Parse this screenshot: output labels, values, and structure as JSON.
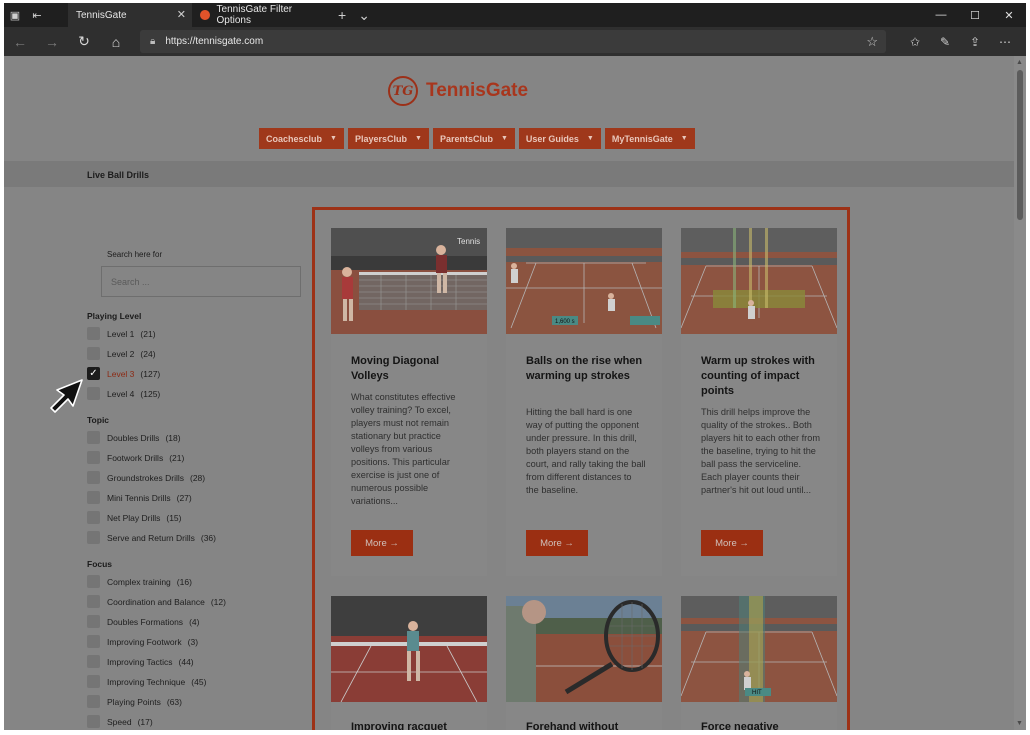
{
  "browser": {
    "tabs": [
      {
        "label": "TennisGate"
      },
      {
        "label": "TennisGate Filter Options"
      }
    ],
    "url": "https://tennisgate.com"
  },
  "site": {
    "logo_text": "TennisGate",
    "logo_mark": "TG",
    "menu": [
      "Coachesclub",
      "PlayersClub",
      "ParentsClub",
      "User Guides",
      "MyTennisGate"
    ],
    "breadcrumb": "Live Ball Drills"
  },
  "filters": {
    "search_label": "Search here for",
    "search_placeholder": "Search ...",
    "groups": [
      {
        "title": "Playing Level",
        "options": [
          {
            "label": "Level 1",
            "count": "(21)",
            "checked": false
          },
          {
            "label": "Level 2",
            "count": "(24)",
            "checked": false
          },
          {
            "label": "Level 3",
            "count": "(127)",
            "checked": true
          },
          {
            "label": "Level 4",
            "count": "(125)",
            "checked": false
          }
        ]
      },
      {
        "title": "Topic",
        "options": [
          {
            "label": "Doubles Drills",
            "count": "(18)",
            "checked": false
          },
          {
            "label": "Footwork Drills",
            "count": "(21)",
            "checked": false
          },
          {
            "label": "Groundstrokes Drills",
            "count": "(28)",
            "checked": false
          },
          {
            "label": "Mini Tennis Drills",
            "count": "(27)",
            "checked": false
          },
          {
            "label": "Net Play Drills",
            "count": "(15)",
            "checked": false
          },
          {
            "label": "Serve and Return Drills",
            "count": "(36)",
            "checked": false
          }
        ]
      },
      {
        "title": "Focus",
        "options": [
          {
            "label": "Complex training",
            "count": "(16)",
            "checked": false
          },
          {
            "label": "Coordination and Balance",
            "count": "(12)",
            "checked": false
          },
          {
            "label": "Doubles Formations",
            "count": "(4)",
            "checked": false
          },
          {
            "label": "Improving Footwork",
            "count": "(3)",
            "checked": false
          },
          {
            "label": "Improving Tactics",
            "count": "(44)",
            "checked": false
          },
          {
            "label": "Improving Technique",
            "count": "(45)",
            "checked": false
          },
          {
            "label": "Playing Points",
            "count": "(63)",
            "checked": false
          },
          {
            "label": "Speed",
            "count": "(17)",
            "checked": false
          }
        ]
      }
    ]
  },
  "cards": [
    {
      "title": "Moving Diagonal Volleys",
      "desc": "What constitutes effective volley training? To excel, players must not remain stationary but practice volleys from various positions. This particular exercise is just one of numerous possible variations...",
      "button": "More →",
      "img_text": "Tennis"
    },
    {
      "title": "Balls on the rise when warming up strokes",
      "desc": "Hitting the ball hard is one way of putting the opponent under pressure. In this drill, both players stand on the court, and rally taking the ball from different distances to the baseline.",
      "button": "More →",
      "img_text": "1,600 s"
    },
    {
      "title": "Warm up strokes with counting of impact points",
      "desc": "This drill helps improve the quality of the strokes.. Both players hit to each other from the baseline, trying to hit the ball pass the serviceline. Each player counts their partner's hit out loud until...",
      "button": "More →",
      "img_text": ""
    },
    {
      "title": "Improving racquet",
      "desc": "",
      "button": "",
      "img_text": ""
    },
    {
      "title": "Forehand without",
      "desc": "",
      "button": "",
      "img_text": ""
    },
    {
      "title": "Force negative",
      "desc": "",
      "button": "",
      "img_text": "HIT"
    }
  ],
  "colors": {
    "brand": "#e0532a",
    "overlay": "#858585"
  }
}
